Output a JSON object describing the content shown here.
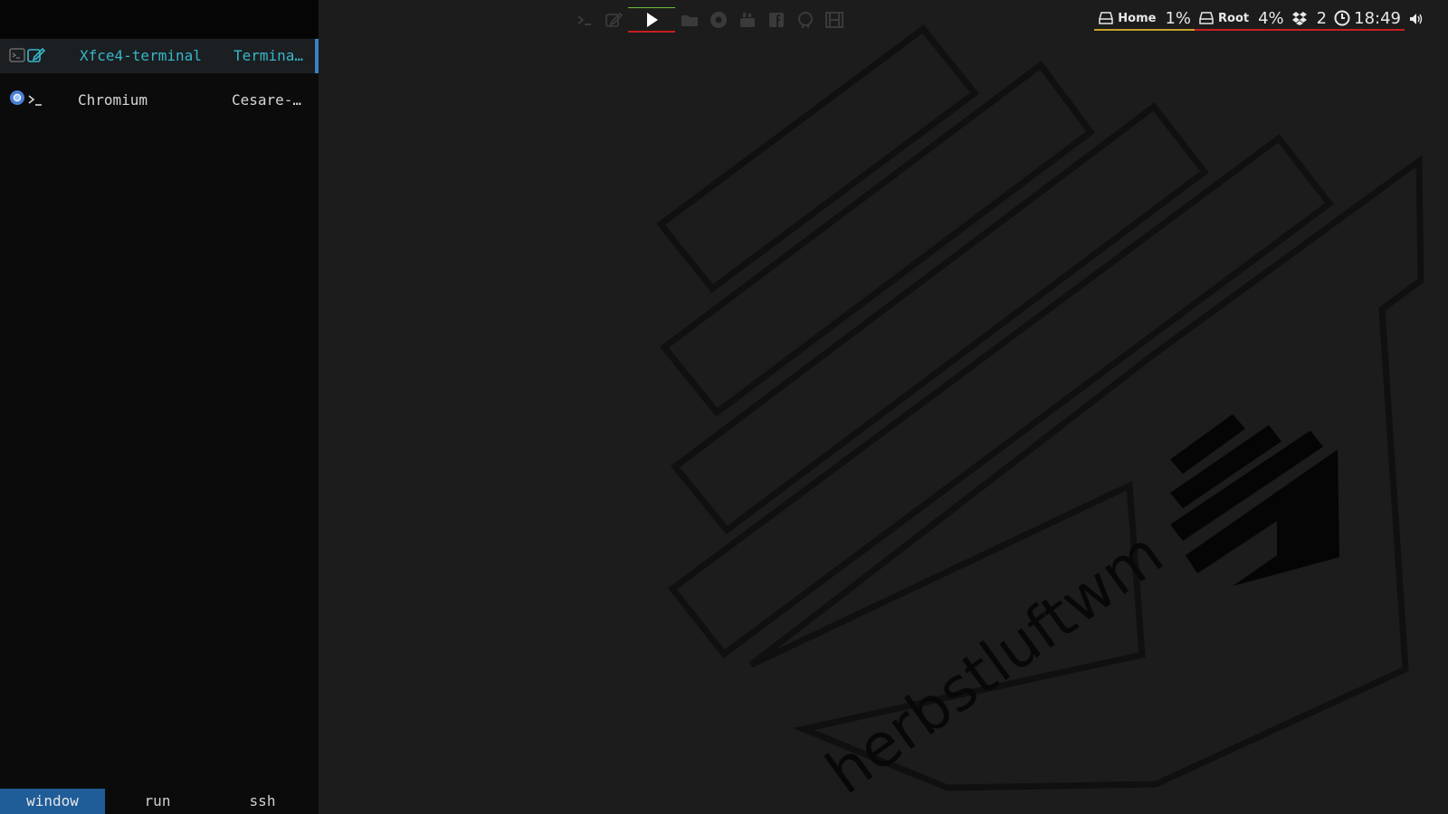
{
  "launcher": {
    "rows": [
      {
        "app": "Xfce4-terminal",
        "title": "Termina…",
        "selected": true
      },
      {
        "app": "Chromium",
        "title": "Cesare-…",
        "selected": false
      }
    ],
    "modes": [
      {
        "label": "window",
        "active": true
      },
      {
        "label": "run",
        "active": false
      },
      {
        "label": "ssh",
        "active": false
      }
    ]
  },
  "dock": {
    "items": [
      "terminal-icon",
      "edit-icon",
      "play-icon",
      "folder-icon",
      "chrome-icon",
      "youtube-icon",
      "facebook-icon",
      "github-icon",
      "film-icon"
    ]
  },
  "status": {
    "home_label": "Home",
    "home_usage": "1%",
    "root_label": "Root",
    "root_usage": "4%",
    "dropbox_count": "2",
    "time": "18:49"
  },
  "wallpaper": {
    "text": "herbstluftwm"
  },
  "colors": {
    "accent_blue": "#1f5d99",
    "selected_text": "#38b6c8",
    "underline_red": "#c81e1e",
    "underline_yellow": "#c9a227",
    "underline_green": "#6fbf3a"
  }
}
